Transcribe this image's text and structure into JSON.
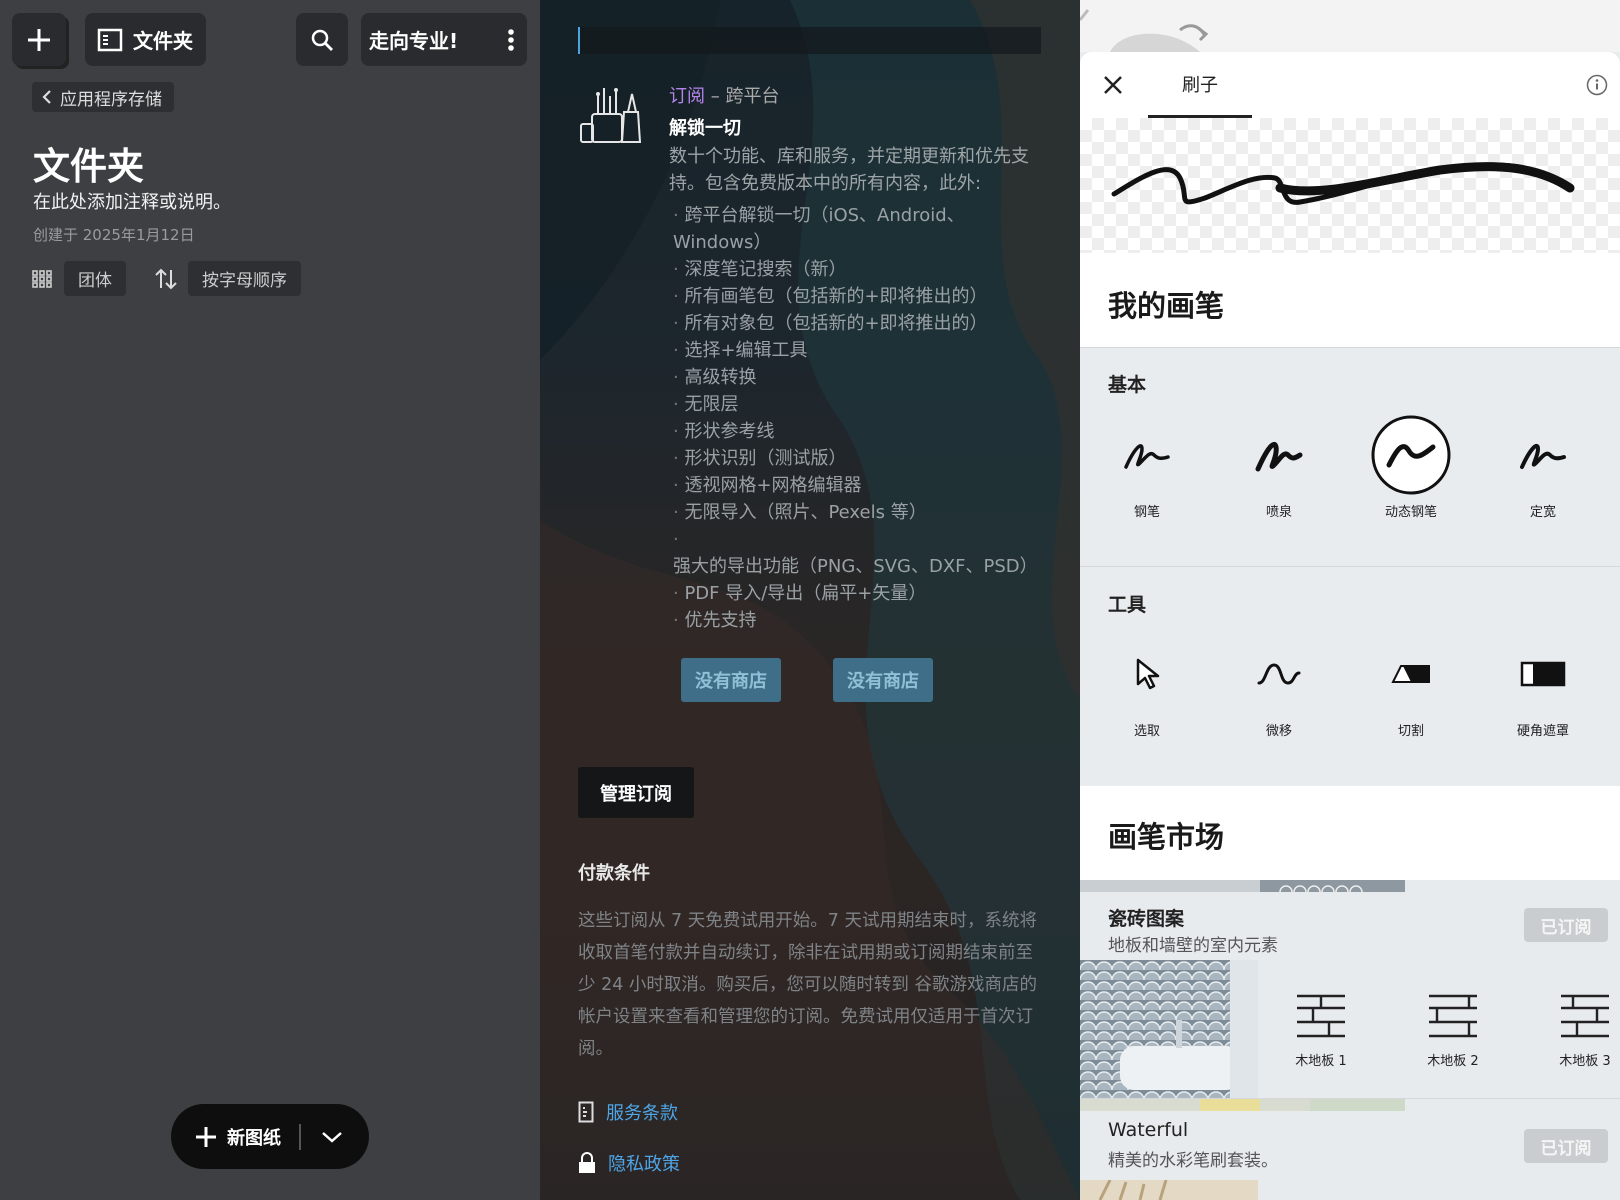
{
  "left": {
    "folder_button_label": "文件夹",
    "pro_button_label": "走向专业!",
    "breadcrumb": "应用程序存储",
    "title": "文件夹",
    "description": "在此处添加注释或说明。",
    "created": "创建于 2025年1月12日",
    "view_mode": "团体",
    "sort_mode": "按字母顺序",
    "new_sheet_label": "新图纸"
  },
  "subscription": {
    "label": "订阅",
    "platform": " – 跨平台",
    "unlock_title": "解锁一切",
    "description": "数十个功能、库和服务，并定期更新和优先支持。包含免费版本中的所有内容，此外:",
    "features": [
      "跨平台解锁一切（iOS、Android、Windows）",
      "深度笔记搜索（新）",
      "所有画笔包（包括新的+即将推出的）",
      "所有对象包（包括新的+即将推出的）",
      "选择+编辑工具",
      "高级转换",
      "无限层",
      "形状参考线",
      "形状识别（测试版）",
      "透视网格+网格编辑器",
      "无限导入（照片、Pexels 等）",
      "强大的导出功能（PNG、SVG、DXF、PSD）",
      "PDF 导入/导出（扁平+矢量）",
      "优先支持"
    ],
    "store_button_1": "没有商店",
    "store_button_2": "没有商店",
    "manage_button": "管理订阅",
    "terms_title": "付款条件",
    "terms_text": "这些订阅从 7 天免费试用开始。7 天试用期结束时，系统将收取首笔付款并自动续订，除非在试用期或订阅期结束前至少 24 小时取消。购买后，您可以随时转到 谷歌游戏商店的帐户设置来查看和管理您的订阅。免费试用仅适用于首次订阅。",
    "terms_link": "服务条款",
    "privacy_link": "隐私政策",
    "accent_color": "#b484ec",
    "link_color": "#4ea6e8"
  },
  "brushes": {
    "tab_label": "刷子",
    "my_brushes_title": "我的画笔",
    "basic_label": "基本",
    "basic_items": [
      "钢笔",
      "喷泉",
      "动态钢笔",
      "定宽"
    ],
    "selected_basic": "动态钢笔",
    "tools_label": "工具",
    "tool_items": [
      "选取",
      "微移",
      "切割",
      "硬角遮罩"
    ],
    "market_title": "画笔市场",
    "packs": [
      {
        "name": "瓷砖图案",
        "description": "地板和墙壁的室内元素",
        "status": "已订阅",
        "items": [
          "木地板 1",
          "木地板 2",
          "木地板 3"
        ]
      },
      {
        "name": "Waterful",
        "description": "精美的水彩笔刷套装。",
        "status": "已订阅"
      }
    ]
  }
}
